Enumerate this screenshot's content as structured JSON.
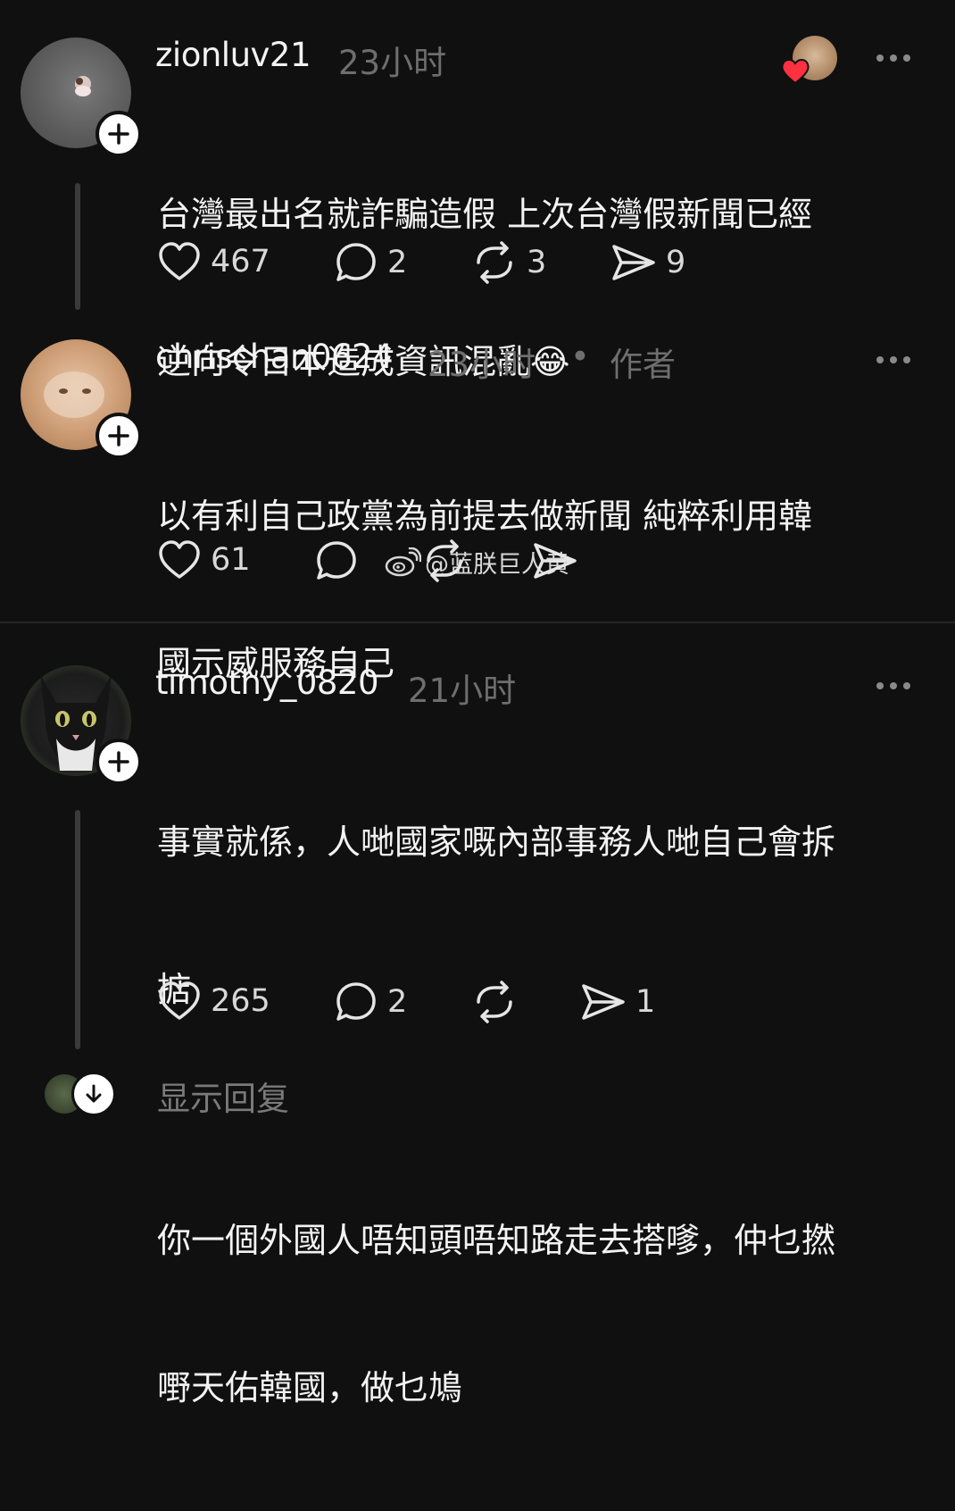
{
  "comments": [
    {
      "username": "zionluv21",
      "time": "23小时",
      "text_lines": [
        "台灣最出名就詐騙造假 上次台灣假新聞已經",
        "逆向令日本造成資訊混亂😂"
      ],
      "likes": "467",
      "replies": "2",
      "reposts": "3",
      "shares": "9"
    },
    {
      "username": "chrischan0624",
      "time": "23小时",
      "separator": "•",
      "author_tag": "作者",
      "text_lines": [
        "以有利自己政黨為前提去做新聞 純粹利用韓",
        "國示威服務自己"
      ],
      "likes": "61"
    },
    {
      "username": "timothy_0820",
      "time": "21小时",
      "text_lines": [
        "事實就係，人哋國家嘅內部事務人哋自己會拆",
        "掂",
        "你一個外國人唔知頭唔知路走去搭嗲，仲乜撚",
        "嘢天佑韓國，做乜鳩"
      ],
      "likes": "265",
      "replies": "2",
      "shares": "1"
    }
  ],
  "watermark": "@蓝朕巨人黄",
  "show_replies": "显示回复",
  "colors": {
    "background": "#101010",
    "text": "#f3f3f3",
    "muted": "#6e6e6e",
    "heart": "#ff3040"
  }
}
